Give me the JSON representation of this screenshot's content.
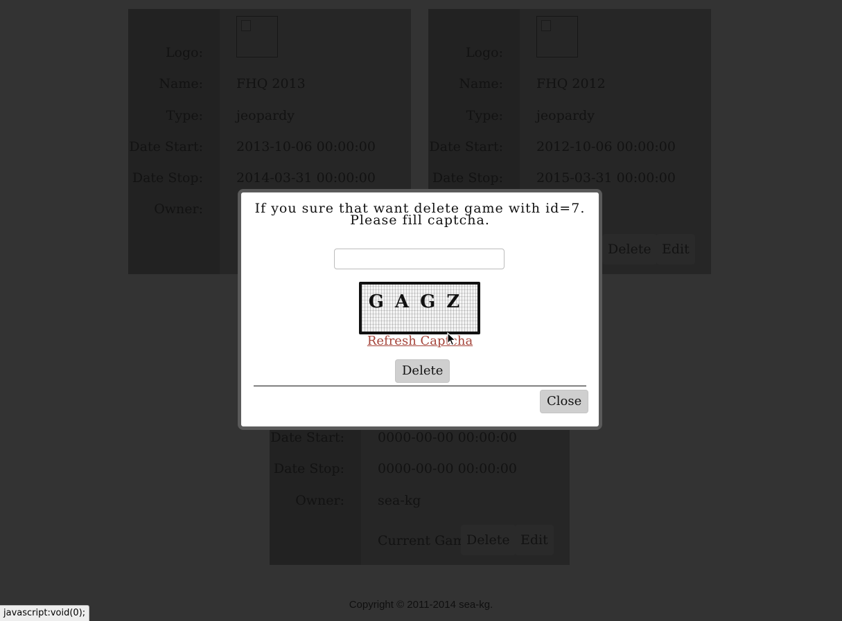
{
  "labels": {
    "logo": "Logo:",
    "name": "Name:",
    "type": "Type:",
    "date_start": "Date Start:",
    "date_stop": "Date Stop:",
    "owner": "Owner:"
  },
  "games": [
    {
      "name": "FHQ 2013",
      "type": "jeopardy",
      "date_start": "2013-10-06 00:00:00",
      "date_stop": "2014-03-31 00:00:00"
    },
    {
      "name": "FHQ 2012",
      "type": "jeopardy",
      "date_start": "2012-10-06 00:00:00",
      "date_stop": "2015-03-31 00:00:00",
      "delete_label": "Delete",
      "edit_label": "Edit"
    },
    {
      "date_start": "0000-00-00 00:00:00",
      "date_stop": "0000-00-00 00:00:00",
      "owner": "sea-kg",
      "current_label": "Current Game",
      "delete_label": "Delete",
      "edit_label": "Edit"
    }
  ],
  "dialog": {
    "message_line1": "If you sure that want delete game with id=7.",
    "message_line2": "Please fill captcha.",
    "captcha_input_value": "",
    "captcha_chars": "GAGZ",
    "refresh_label": "Refresh Captcha",
    "delete_label": "Delete",
    "close_label": "Close"
  },
  "footer": {
    "copyright": "Copyright © 2011-2014 sea-kg."
  },
  "status_bar": {
    "text": "javascript:void(0);"
  },
  "colors": {
    "overlay": "#333333",
    "link": "#a5443a",
    "dialog_border": "#5a5a5a"
  },
  "icons": {
    "logo_placeholder": "broken-image-icon",
    "cursor": "mouse-pointer-icon"
  }
}
